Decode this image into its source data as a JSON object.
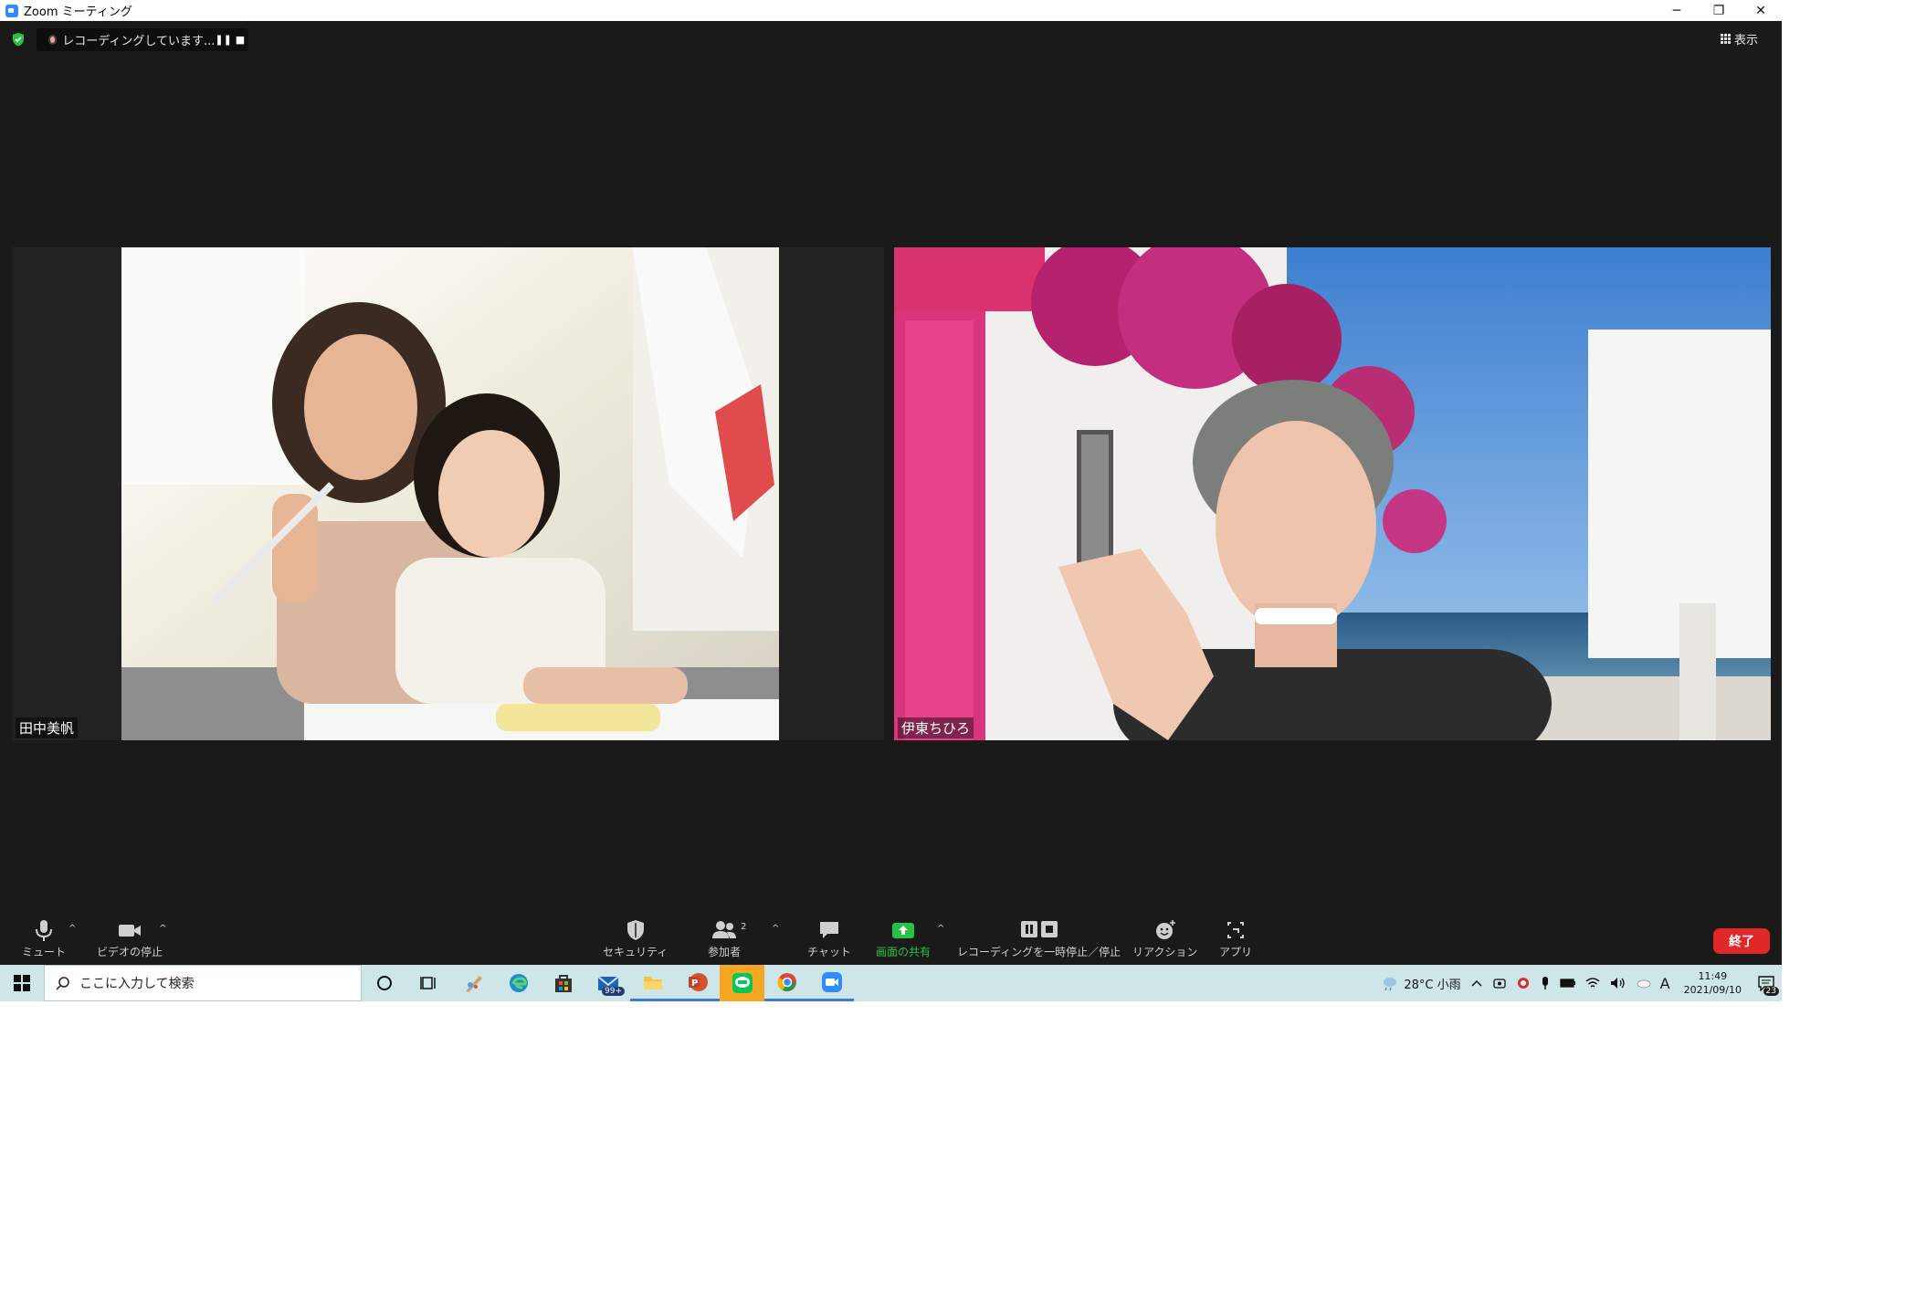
{
  "window": {
    "title": "Zoom ミーティング",
    "controls": {
      "minimize": "─",
      "restore": "❐",
      "close": "✕"
    }
  },
  "recording": {
    "status": "レコーディングしています...",
    "pause": "❚❚",
    "stop": "■"
  },
  "view": {
    "label": "表示"
  },
  "participants": [
    {
      "name": "田中美帆"
    },
    {
      "name": "伊東ちひろ"
    }
  ],
  "toolbar": {
    "mute": "ミュート",
    "video": "ビデオの停止",
    "security": "セキュリティ",
    "participants": "参加者",
    "participants_count": "2",
    "chat": "チャット",
    "share": "画面の共有",
    "record": "レコーディングを一時停止／停止",
    "reactions": "リアクション",
    "apps": "アプリ",
    "caret": "^",
    "end": "終了"
  },
  "taskbar": {
    "search_placeholder": "ここに入力して検索",
    "mail_badge": "99+",
    "weather": "28°C  小雨",
    "time": "11:49",
    "date": "2021/09/10",
    "ime": "A",
    "notifications": "23"
  },
  "colors": {
    "zoom_bg": "#1a1a1a",
    "share_green": "#27c245",
    "end_red": "#e02828",
    "taskbar": "#cfe6e8"
  }
}
